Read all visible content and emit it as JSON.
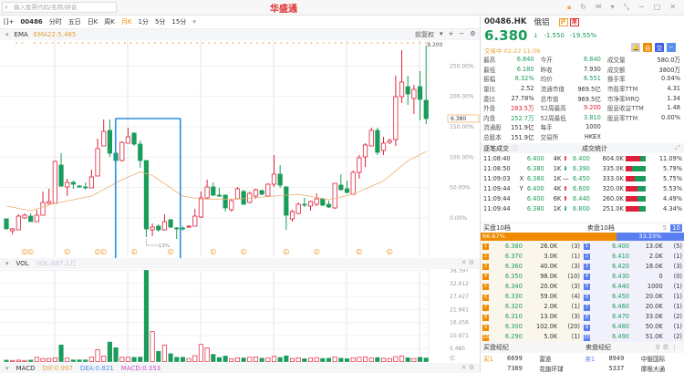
{
  "app": {
    "logo": "华盛通",
    "search_placeholder": "输入股票代码/名称/拼音"
  },
  "toolbar": {
    "code": "00486",
    "tabs": [
      "分时",
      "五日",
      "日K",
      "周K",
      "月K",
      "1分",
      "5分",
      "15分"
    ],
    "active_tab": "月K"
  },
  "main": {
    "ema_label": "EMA",
    "ema_value": "EMA22:5.485",
    "adjust": "前复权",
    "max_label": "9.200",
    "current_tag": "6.380",
    "selection_label": "13%",
    "event_marker": "E",
    "vol_label": "VOL",
    "vol_value": "VOL:687.1万",
    "macd_label": "MACD",
    "dif": "DIF:0.997",
    "dea": "DEA:0.821",
    "macd": "MACD:0.353"
  },
  "chart_data": [
    {
      "type": "candlestick",
      "title": "00486.HK 月K",
      "ylabel": "%",
      "ylim": [
        -40,
        290
      ],
      "yticks": [
        "250.00%",
        "200.00%",
        "150.00%",
        "100.00%",
        "50.00%",
        "0.00%"
      ],
      "ytick_values": [
        250,
        200,
        150,
        100,
        50,
        0
      ],
      "ohlc": [
        [
          -1.5,
          -18,
          -1.5,
          -18
        ],
        [
          -21,
          -18,
          -16.5,
          -27
        ],
        [
          -19.5,
          3,
          6,
          -19.5
        ],
        [
          0,
          4.5,
          7.5,
          -1.5
        ],
        [
          3,
          -6,
          7.5,
          -6
        ],
        [
          -6,
          4.5,
          13.5,
          -6
        ],
        [
          4.5,
          25.5,
          43.5,
          4.5
        ],
        [
          24,
          27,
          48,
          22.5
        ],
        [
          24,
          93,
          94.5,
          24
        ],
        [
          87,
          52.5,
          106.5,
          51
        ],
        [
          51,
          58.5,
          64.5,
          36
        ],
        [
          58.5,
          55.5,
          61.5,
          48
        ],
        [
          52.5,
          51,
          54,
          49.5
        ],
        [
          51,
          49.5,
          58.5,
          46.5
        ],
        [
          49.5,
          67.5,
          79.5,
          49.5
        ],
        [
          69,
          114,
          130.5,
          69
        ],
        [
          118.5,
          142.5,
          162,
          118.5
        ],
        [
          144,
          106.5,
          162,
          100.5
        ],
        [
          106.5,
          94.5,
          109.5,
          93
        ],
        [
          94.5,
          124.5,
          126,
          93
        ],
        [
          123,
          133.5,
          148.5,
          123
        ],
        [
          139.5,
          121.5,
          141,
          118.5
        ],
        [
          121.5,
          94.5,
          127.5,
          82.5
        ],
        [
          94.5,
          -18,
          94.5,
          -31.5
        ],
        [
          -19.5,
          -15,
          -9,
          -30
        ],
        [
          -13.5,
          -19.5,
          -10.5,
          -22.5
        ],
        [
          -19.5,
          -6,
          6,
          -21
        ],
        [
          -3,
          -15,
          -1.5,
          -16.5
        ],
        [
          -16.5,
          -17,
          -15,
          -34.5
        ],
        [
          -16.5,
          -18,
          -13.5,
          -21
        ],
        [
          -15,
          -13.5,
          -12,
          -16.5
        ],
        [
          -13.5,
          3,
          15,
          -13.5
        ],
        [
          1.5,
          33,
          43.5,
          0
        ],
        [
          33,
          51,
          63,
          31.5
        ],
        [
          51,
          37.5,
          58.5,
          36
        ],
        [
          37.5,
          36,
          49.5,
          34.5
        ],
        [
          37.5,
          16.5,
          39,
          10.5
        ],
        [
          13.5,
          28.5,
          31.5,
          10.5
        ],
        [
          31.5,
          48,
          51,
          30
        ],
        [
          43.5,
          22.5,
          46.5,
          22.5
        ],
        [
          25.5,
          40.5,
          43.5,
          24
        ],
        [
          36,
          46.5,
          48,
          31.5
        ],
        [
          45,
          39,
          46.5,
          37.5
        ],
        [
          36,
          55.5,
          57,
          36
        ],
        [
          55.5,
          72,
          103.5,
          51
        ],
        [
          72,
          54,
          87,
          49.5
        ],
        [
          51,
          4.5,
          52.5,
          -19.5
        ],
        [
          -1.5,
          10.5,
          13.5,
          -6
        ],
        [
          7.5,
          22.5,
          25.5,
          6
        ],
        [
          22.5,
          21,
          33,
          18
        ],
        [
          19.5,
          27,
          28.5,
          12
        ],
        [
          22.5,
          31.5,
          40.5,
          19.5
        ],
        [
          31.5,
          21,
          33,
          19.5
        ],
        [
          22.5,
          18,
          28.5,
          16.5
        ],
        [
          16.5,
          57,
          57,
          15
        ],
        [
          54,
          46.5,
          72,
          45
        ],
        [
          48,
          42,
          61.5,
          40.5
        ],
        [
          39,
          75,
          78,
          37.5
        ],
        [
          75,
          99,
          103.5,
          64.5
        ],
        [
          100.5,
          120,
          123,
          84
        ],
        [
          118.5,
          144,
          148.5,
          118.5
        ],
        [
          144,
          108,
          148.5,
          103.5
        ],
        [
          111,
          123,
          133.5,
          103.5
        ],
        [
          124.5,
          127.5,
          130.5,
          121.5
        ],
        [
          129,
          199.5,
          234,
          118.5
        ],
        [
          199.5,
          223.5,
          276,
          189
        ],
        [
          216,
          204,
          234,
          186
        ],
        [
          196.5,
          211.5,
          219,
          171
        ],
        [
          216,
          195,
          241.5,
          160.5
        ],
        [
          193.5,
          163.5,
          283.5,
          154.5
        ]
      ],
      "ema_keypoints": [
        [
          0,
          19.5
        ],
        [
          4,
          12
        ],
        [
          8,
          24
        ],
        [
          14,
          36
        ],
        [
          19,
          63
        ],
        [
          22,
          76
        ],
        [
          24,
          70
        ],
        [
          29,
          36
        ],
        [
          32,
          31
        ],
        [
          38,
          31
        ],
        [
          44,
          36
        ],
        [
          48,
          39
        ],
        [
          53,
          30
        ],
        [
          57,
          39
        ],
        [
          62,
          61
        ],
        [
          66,
          94
        ],
        [
          69,
          109
        ]
      ],
      "event_marker_indices": [
        3,
        4,
        10,
        15,
        16,
        21,
        27,
        34,
        39,
        46,
        51,
        58,
        63
      ],
      "selection_range": [
        19,
        28
      ]
    },
    {
      "type": "bar",
      "title": "VOL",
      "unit": "亿",
      "ylim": [
        0,
        38.397
      ],
      "yticks": [
        "38.397",
        "32.912",
        "27.427",
        "21.941",
        "16.456",
        "10.971",
        "5.485"
      ],
      "ytick_values": [
        38.397,
        32.912,
        27.427,
        21.941,
        16.456,
        10.971,
        5.485
      ],
      "values": [
        0.6,
        0.5,
        0.6,
        0.5,
        0.6,
        1.8,
        1.3,
        1.3,
        1.6,
        7.0,
        1.5,
        0.7,
        0.7,
        0.7,
        1.9,
        5.0,
        2.3,
        8.2,
        5.8,
        1.8,
        1.8,
        1.8,
        1.9,
        38.4,
        12.6,
        4.3,
        7.0,
        3.3,
        1.8,
        1.8,
        1.3,
        2.5,
        7.2,
        5.8,
        3.0,
        1.7,
        2.3,
        1.2,
        1.6,
        1.5,
        1.8,
        2.0,
        1.4,
        1.5,
        2.2,
        1.7,
        2.4,
        1.3,
        1.6,
        1.2,
        1.5,
        1.7,
        1.3,
        1.4,
        2.0,
        1.4,
        1.2,
        1.6,
        1.8,
        2.0,
        1.5,
        1.7,
        1.4,
        1.3,
        2.1,
        2.4,
        1.6,
        1.3,
        1.8,
        1.5
      ]
    }
  ],
  "quote": {
    "code": "00486.HK",
    "name": "俄铝",
    "badges": [
      "沪",
      "港"
    ],
    "price": "6.380",
    "arrow": "↓",
    "change": "-1.550",
    "change_pct": "-19.55%",
    "status": "交易中 02-22 11:09",
    "buttons": [
      "🔔",
      "自",
      "交",
      "−"
    ],
    "stats": [
      [
        "最高",
        "6.840",
        "今开",
        "6.840",
        "成交量",
        "580.0万"
      ],
      [
        "最低",
        "6.180",
        "昨收",
        "7.930",
        "成交额",
        "3800万"
      ],
      [
        "振幅",
        "8.32%",
        "均价",
        "6.551",
        "换手率",
        "0.04%"
      ],
      [
        "量比",
        "2.52",
        "流通市值",
        "969.5亿",
        "市盈率TTM",
        "4.31"
      ],
      [
        "委比",
        "27.78%",
        "总市值",
        "969.5亿",
        "市净率MRQ",
        "1.34"
      ],
      [
        "外盘",
        "283.5万",
        "52周最高",
        "9.200",
        "股息收益TTM",
        "1.48"
      ],
      [
        "内盘",
        "252.7万",
        "52周最低",
        "3.810",
        "股息率TTM",
        "0.00%"
      ],
      [
        "流通股",
        "151.9亿",
        "每手",
        "1000",
        "",
        ""
      ],
      [
        "总股本",
        "151.9亿",
        "交易所",
        "HKEX",
        "",
        ""
      ]
    ]
  },
  "ticks": {
    "title": "逐笔成交",
    "stats_title": "成交统计",
    "rows": [
      {
        "time": "11:08:40",
        "flag": "",
        "price": "6.400",
        "vol": "4K",
        "dir": "up",
        "s_price": "6.400",
        "s_vol": "604.0K",
        "s_pct": "11.09%",
        "s_buy": 0.75
      },
      {
        "time": "11:08:50",
        "flag": "",
        "price": "6.380",
        "vol": "1K",
        "dir": "down",
        "s_price": "6.390",
        "s_vol": "335.0K",
        "s_pct": "5.79%",
        "s_buy": 0.35
      },
      {
        "time": "11:09:03",
        "flag": "X",
        "price": "6.380",
        "vol": "1K",
        "dir": "flat",
        "s_price": "6.450",
        "s_vol": "333.0K",
        "s_pct": "5.75%",
        "s_buy": 0.45
      },
      {
        "time": "11:09:44",
        "flag": "Y",
        "price": "6.400",
        "vol": "4K",
        "dir": "up",
        "s_price": "6.600",
        "s_vol": "320.0K",
        "s_pct": "5.53%",
        "s_buy": 0.6
      },
      {
        "time": "11:09:44",
        "flag": "",
        "price": "6.400",
        "vol": "6K",
        "dir": "up",
        "s_price": "6.440",
        "s_vol": "260.0K",
        "s_pct": "4.49%",
        "s_buy": 0.6
      },
      {
        "time": "11:09:44",
        "flag": "",
        "price": "6.380",
        "vol": "1K",
        "dir": "down",
        "s_price": "6.800",
        "s_vol": "251.0K",
        "s_pct": "4.34%",
        "s_buy": 0.7
      }
    ]
  },
  "orderbook": {
    "bid_title": "买盘10档",
    "ask_title": "卖盘10档",
    "depth_options": [
      "5",
      "10"
    ],
    "bid_pct": "66.67%",
    "ask_pct": "33.33%",
    "bid_ratio": 66.67,
    "bids": [
      [
        "1",
        "6.380",
        "26.0K",
        "(3)"
      ],
      [
        "2",
        "6.370",
        "3.0K",
        "(1)"
      ],
      [
        "3",
        "6.360",
        "40.0K",
        "(3)"
      ],
      [
        "4",
        "6.350",
        "98.0K",
        "(10)"
      ],
      [
        "5",
        "6.340",
        "20.0K",
        "(3)"
      ],
      [
        "6",
        "6.330",
        "59.0K",
        "(4)"
      ],
      [
        "7",
        "6.320",
        "2.0K",
        "(1)"
      ],
      [
        "8",
        "6.310",
        "13.0K",
        "(3)"
      ],
      [
        "9",
        "6.300",
        "102.0K",
        "(20)"
      ],
      [
        "10",
        "6.290",
        "5.0K",
        "(1)"
      ]
    ],
    "asks": [
      [
        "1",
        "6.400",
        "13.0K",
        "(5)"
      ],
      [
        "2",
        "6.410",
        "2.0K",
        "(1)"
      ],
      [
        "3",
        "6.420",
        "18.0K",
        "(3)"
      ],
      [
        "4",
        "6.430",
        "0",
        "(0)"
      ],
      [
        "5",
        "6.440",
        "1000",
        "(1)"
      ],
      [
        "6",
        "6.450",
        "20.0K",
        "(1)"
      ],
      [
        "7",
        "6.460",
        "20.0K",
        "(1)"
      ],
      [
        "8",
        "6.470",
        "33.0K",
        "(2)"
      ],
      [
        "9",
        "6.480",
        "50.0K",
        "(1)"
      ],
      [
        "10",
        "6.490",
        "51.0K",
        "(2)"
      ]
    ]
  },
  "brokers": {
    "bid_title": "买盘经纪",
    "ask_title": "卖盘经纪",
    "rows": [
      [
        "买1",
        "6699",
        "富途",
        "卖1",
        "8949",
        "中银国际"
      ],
      [
        "",
        "7389",
        "花旗环球",
        "",
        "5337",
        "摩根大通"
      ]
    ]
  },
  "colors": {
    "up": "#e0203a",
    "down": "#1a9c5b",
    "ema": "#e8b070",
    "selection": "#2a8ee0",
    "accent": "#f08a00",
    "ask": "#5a7ff0"
  }
}
